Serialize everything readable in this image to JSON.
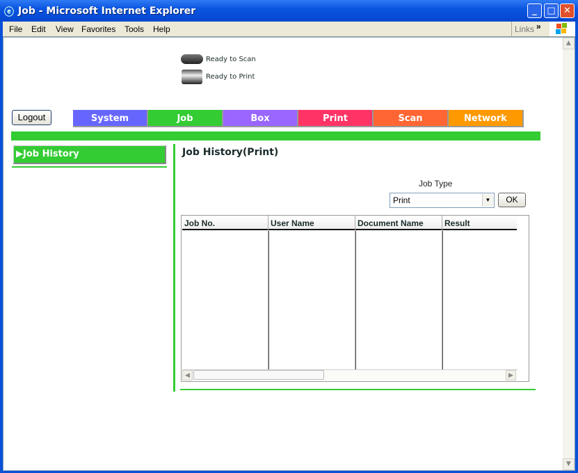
{
  "window": {
    "title": "Job - Microsoft Internet Explorer",
    "icon": "ie-icon"
  },
  "menu": [
    "File",
    "Edit",
    "View",
    "Favorites",
    "Tools",
    "Help"
  ],
  "links_label": "Links",
  "status": {
    "scan": "Ready to Scan",
    "print": "Ready to Print"
  },
  "logout_label": "Logout",
  "tabs": [
    {
      "label": "System",
      "color": "#6666ff"
    },
    {
      "label": "Job",
      "color": "#33cc33"
    },
    {
      "label": "Box",
      "color": "#9966ff"
    },
    {
      "label": "Print",
      "color": "#ff3366"
    },
    {
      "label": "Scan",
      "color": "#ff6633"
    },
    {
      "label": "Network",
      "color": "#ff9900"
    }
  ],
  "accent": "#33cc33",
  "sidebar": {
    "items": [
      {
        "label": "Job History"
      }
    ]
  },
  "main": {
    "title": "Job History(Print)",
    "job_type_label": "Job Type",
    "job_type_value": "Print",
    "ok_label": "OK",
    "columns": [
      "Job No.",
      "User Name",
      "Document Name",
      "Result"
    ],
    "rows": []
  }
}
